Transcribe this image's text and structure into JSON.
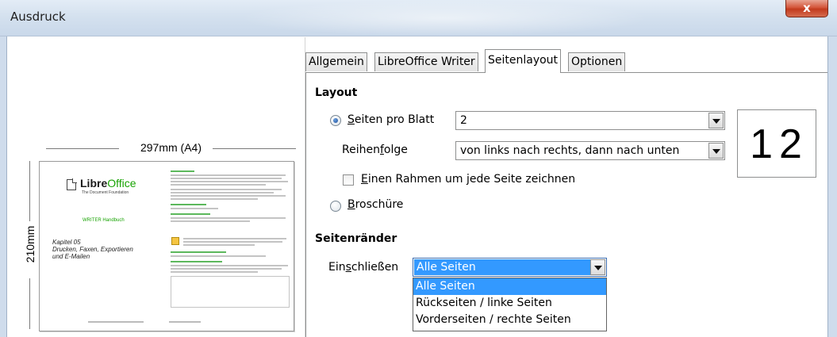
{
  "window": {
    "title": "Ausdruck",
    "close_glyph": "x"
  },
  "preview": {
    "width_label": "297mm (A4)",
    "height_label": "210mm",
    "left_page": {
      "logo_name_bold": "Libre",
      "logo_name_accent": "Office",
      "logo_sub": "The Document Foundation",
      "handbook": "WRITER Handbuch",
      "chapter_lines": [
        "Kapitel 05",
        "Drucken, Faxen, Exportieren",
        "und E-Mailen"
      ]
    }
  },
  "tabs": [
    {
      "label": "Allgemein",
      "active": false
    },
    {
      "label": "LibreOffice Writer",
      "active": false
    },
    {
      "label": "Seitenlayout",
      "active": true
    },
    {
      "label": "Optionen",
      "active": false
    }
  ],
  "layout": {
    "title": "Layout",
    "pages_per_sheet": {
      "label_pre": "",
      "label_u": "S",
      "label_post": "eiten pro Blatt",
      "value": "2",
      "checked": true
    },
    "order": {
      "label_pre": "Reihen",
      "label_u": "f",
      "label_post": "olge",
      "value": "von links nach rechts, dann nach unten"
    },
    "border": {
      "label_pre": "",
      "label_u": "E",
      "label_post": "inen Rahmen um jede Seite zeichnen",
      "checked": false
    },
    "brochure": {
      "label_pre": "",
      "label_u": "B",
      "label_post": "roschüre",
      "checked": false
    },
    "page_number_preview": "12"
  },
  "margins": {
    "title": "Seitenränder",
    "include": {
      "label_pre": "Ein",
      "label_u": "s",
      "label_post": "chließen",
      "value": "Alle Seiten",
      "options": [
        "Alle Seiten",
        "Rückseiten / linke Seiten",
        "Vorderseiten / rechte Seiten"
      ],
      "highlighted_index": 0
    }
  }
}
